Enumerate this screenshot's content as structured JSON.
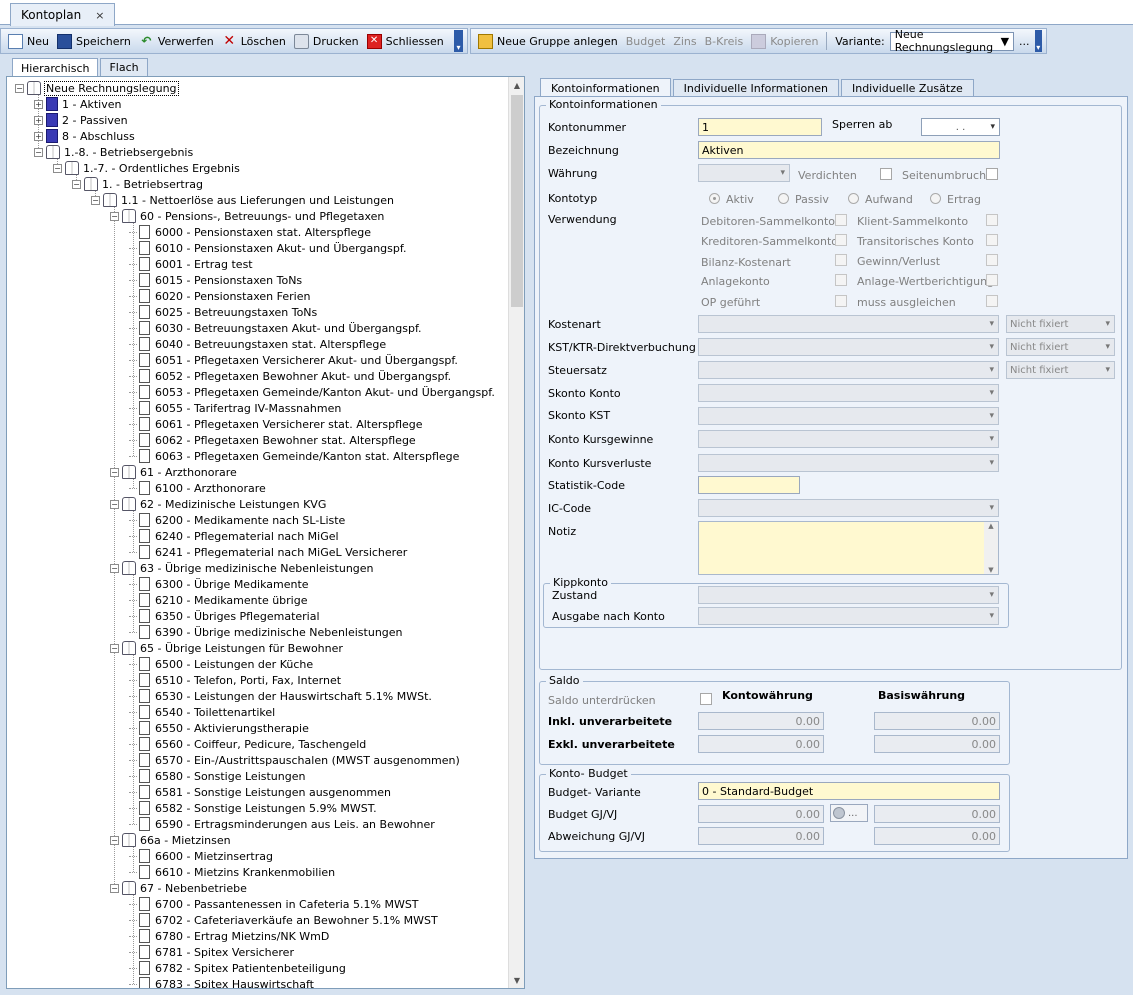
{
  "doc_tab": {
    "title": "Kontoplan",
    "close": "×"
  },
  "toolbar": {
    "new": "Neu",
    "save": "Speichern",
    "discard": "Verwerfen",
    "delete": "Löschen",
    "print": "Drucken",
    "close": "Schliessen",
    "new_group": "Neue Gruppe anlegen",
    "budget": "Budget",
    "zins": "Zins",
    "bkreis": "B-Kreis",
    "copy": "Kopieren",
    "variant_label": "Variante:",
    "variant_value": "Neue Rechnungslegung",
    "more": "..."
  },
  "left_tabs": {
    "hier": "Hierarchisch",
    "flat": "Flach"
  },
  "tree": [
    {
      "d": 0,
      "icon": "book",
      "exp": "−",
      "label": "Neue Rechnungslegung",
      "sel": true
    },
    {
      "d": 1,
      "icon": "folder",
      "exp": "+",
      "label": "1 - Aktiven"
    },
    {
      "d": 1,
      "icon": "folder",
      "exp": "+",
      "label": "2 - Passiven"
    },
    {
      "d": 1,
      "icon": "folder",
      "exp": "+",
      "label": "8 - Abschluss"
    },
    {
      "d": 1,
      "icon": "book",
      "exp": "−",
      "label": "1.-8. - Betriebsergebnis"
    },
    {
      "d": 2,
      "icon": "book",
      "exp": "−",
      "label": "1.-7. - Ordentliches Ergebnis"
    },
    {
      "d": 3,
      "icon": "book",
      "exp": "−",
      "label": "1. - Betriebsertrag"
    },
    {
      "d": 4,
      "icon": "book",
      "exp": "−",
      "label": "1.1 - Nettoerlöse aus Lieferungen und Leistungen"
    },
    {
      "d": 5,
      "icon": "book",
      "exp": "−",
      "label": "60 - Pensions-, Betreuungs- und Pflegetaxen"
    },
    {
      "d": 6,
      "icon": "doc",
      "label": "6000 - Pensionstaxen stat. Alterspflege"
    },
    {
      "d": 6,
      "icon": "doc",
      "label": "6010 - Pensionstaxen Akut- und Übergangspf."
    },
    {
      "d": 6,
      "icon": "doc",
      "label": "6001 - Ertrag test"
    },
    {
      "d": 6,
      "icon": "doc",
      "label": "6015 - Pensionstaxen ToNs"
    },
    {
      "d": 6,
      "icon": "doc",
      "label": "6020 - Pensionstaxen Ferien"
    },
    {
      "d": 6,
      "icon": "doc",
      "label": "6025 - Betreuungstaxen ToNs"
    },
    {
      "d": 6,
      "icon": "doc",
      "label": "6030 - Betreuungstaxen Akut- und Übergangspf."
    },
    {
      "d": 6,
      "icon": "doc",
      "label": "6040 - Betreuungstaxen stat. Alterspflege"
    },
    {
      "d": 6,
      "icon": "doc",
      "label": "6051 - Pflegetaxen Versicherer Akut- und Übergangspf."
    },
    {
      "d": 6,
      "icon": "doc",
      "label": "6052 - Pflegetaxen Bewohner Akut- und Übergangspf."
    },
    {
      "d": 6,
      "icon": "doc",
      "label": "6053 - Pflegetaxen Gemeinde/Kanton Akut- und Übergangspf."
    },
    {
      "d": 6,
      "icon": "doc",
      "label": "6055 - Tarifertrag IV-Massnahmen"
    },
    {
      "d": 6,
      "icon": "doc",
      "label": "6061 - Pflegetaxen Versicherer stat. Alterspflege"
    },
    {
      "d": 6,
      "icon": "doc",
      "label": "6062 - Pflegetaxen Bewohner stat. Alterspflege"
    },
    {
      "d": 6,
      "icon": "doc",
      "label": "6063 - Pflegetaxen Gemeinde/Kanton stat. Alterspflege"
    },
    {
      "d": 5,
      "icon": "book",
      "exp": "−",
      "label": "61 - Arzthonorare"
    },
    {
      "d": 6,
      "icon": "doc",
      "label": "6100 - Arzthonorare"
    },
    {
      "d": 5,
      "icon": "book",
      "exp": "−",
      "label": "62 - Medizinische Leistungen KVG"
    },
    {
      "d": 6,
      "icon": "doc",
      "label": "6200 - Medikamente nach SL-Liste"
    },
    {
      "d": 6,
      "icon": "doc",
      "label": "6240 - Pflegematerial nach MiGel"
    },
    {
      "d": 6,
      "icon": "doc",
      "label": "6241 - Pflegematerial nach MiGeL Versicherer"
    },
    {
      "d": 5,
      "icon": "book",
      "exp": "−",
      "label": "63 - Übrige medizinische Nebenleistungen"
    },
    {
      "d": 6,
      "icon": "doc",
      "label": "6300 - Übrige Medikamente"
    },
    {
      "d": 6,
      "icon": "doc",
      "label": "6210 - Medikamente übrige"
    },
    {
      "d": 6,
      "icon": "doc",
      "label": "6350 - Übriges Pflegematerial"
    },
    {
      "d": 6,
      "icon": "doc",
      "label": "6390 - Übrige medizinische Nebenleistungen"
    },
    {
      "d": 5,
      "icon": "book",
      "exp": "−",
      "label": "65 - Übrige Leistungen für Bewohner"
    },
    {
      "d": 6,
      "icon": "doc",
      "label": "6500 - Leistungen der Küche"
    },
    {
      "d": 6,
      "icon": "doc",
      "label": "6510 - Telefon, Porti, Fax, Internet"
    },
    {
      "d": 6,
      "icon": "doc",
      "label": "6530 - Leistungen der Hauswirtschaft 5.1% MWSt."
    },
    {
      "d": 6,
      "icon": "doc",
      "label": "6540 - Toilettenartikel"
    },
    {
      "d": 6,
      "icon": "doc",
      "label": "6550 - Aktivierungstherapie"
    },
    {
      "d": 6,
      "icon": "doc",
      "label": "6560 - Coiffeur, Pedicure, Taschengeld"
    },
    {
      "d": 6,
      "icon": "doc",
      "label": "6570 - Ein-/Austrittspauschalen (MWST ausgenommen)"
    },
    {
      "d": 6,
      "icon": "doc",
      "label": "6580 - Sonstige Leistungen"
    },
    {
      "d": 6,
      "icon": "doc",
      "label": "6581 - Sonstige Leistungen ausgenommen"
    },
    {
      "d": 6,
      "icon": "doc",
      "label": "6582 - Sonstige Leistungen 5.9% MWST."
    },
    {
      "d": 6,
      "icon": "doc",
      "label": "6590 - Ertragsminderungen aus Leis. an Bewohner"
    },
    {
      "d": 5,
      "icon": "book",
      "exp": "−",
      "label": "66a - Mietzinsen"
    },
    {
      "d": 6,
      "icon": "doc",
      "label": "6600 - Mietzinsertrag"
    },
    {
      "d": 6,
      "icon": "doc",
      "label": "6610 - Mietzins Krankenmobilien"
    },
    {
      "d": 5,
      "icon": "book",
      "exp": "−",
      "label": "67 - Nebenbetriebe"
    },
    {
      "d": 6,
      "icon": "doc",
      "label": "6700 - Passantenessen in Cafeteria 5.1% MWST"
    },
    {
      "d": 6,
      "icon": "doc",
      "label": "6702 - Cafeteriaverkäufe an Bewohner 5.1% MWST"
    },
    {
      "d": 6,
      "icon": "doc",
      "label": "6780 - Ertrag Mietzins/NK WmD"
    },
    {
      "d": 6,
      "icon": "doc",
      "label": "6781 - Spitex Versicherer"
    },
    {
      "d": 6,
      "icon": "doc",
      "label": "6782 - Spitex Patientenbeteiligung"
    },
    {
      "d": 6,
      "icon": "doc",
      "label": "6783 - Spitex Hauswirtschaft"
    }
  ],
  "right_tabs": {
    "t1": "Kontoinformationen",
    "t2": "Individuelle Informationen",
    "t3": "Individuelle Zusätze"
  },
  "form": {
    "group_title": "Kontoinformationen",
    "kontonummer_label": "Kontonummer",
    "kontonummer": "1",
    "sperren_label": "Sperren ab",
    "sperren_value": ". .",
    "bezeichnung_label": "Bezeichnung",
    "bezeichnung": "Aktiven",
    "waehrung_label": "Währung",
    "verdichten": "Verdichten",
    "seitenumbruch": "Seitenumbruch",
    "kontotyp_label": "Kontotyp",
    "aktiv": "Aktiv",
    "passiv": "Passiv",
    "aufwand": "Aufwand",
    "ertrag": "Ertrag",
    "verwendung_label": "Verwendung",
    "debitoren": "Debitoren-Sammelkonto",
    "klient": "Klient-Sammelkonto",
    "kreditoren": "Kreditoren-Sammelkonto",
    "transitorisch": "Transitorisches Konto",
    "bilanz": "Bilanz-Kostenart",
    "gewinn": "Gewinn/Verlust",
    "anlagekonto": "Anlagekonto",
    "anlage_wb": "Anlage-Wertberichtigung",
    "op": "OP geführt",
    "muss": "muss ausgleichen",
    "kostenart_label": "Kostenart",
    "kst_label": "KST/KTR-Direktverbuchung",
    "steuersatz_label": "Steuersatz",
    "nicht_fixiert": "Nicht fixiert",
    "skonto_konto_label": "Skonto Konto",
    "skonto_kst_label": "Skonto KST",
    "kursgewinne_label": "Konto Kursgewinne",
    "kursverluste_label": "Konto Kursverluste",
    "statistik_label": "Statistik-Code",
    "ic_label": "IC-Code",
    "notiz_label": "Notiz",
    "kipp_title": "Kippkonto",
    "zustand_label": "Zustand",
    "ausgabe_label": "Ausgabe nach Konto"
  },
  "saldo": {
    "title": "Saldo",
    "unterdruecken": "Saldo unterdrücken",
    "kontowaehrung": "Kontowährung",
    "basiswaehrung": "Basiswährung",
    "inkl": "Inkl. unverarbeitete",
    "exkl": "Exkl. unverarbeitete",
    "inkl_kw": "0.00",
    "inkl_bw": "0.00",
    "exkl_kw": "0.00",
    "exkl_bw": "0.00"
  },
  "budget": {
    "title": "Konto- Budget",
    "variante_label": "Budget- Variante",
    "variante_value": "0   - Standard-Budget",
    "gjvj_label": "Budget GJ/VJ",
    "gj": "0.00",
    "vj": "0.00",
    "abw_label": "Abweichung GJ/VJ",
    "abw_gj": "0.00",
    "abw_vj": "0.00",
    "more": "..."
  }
}
